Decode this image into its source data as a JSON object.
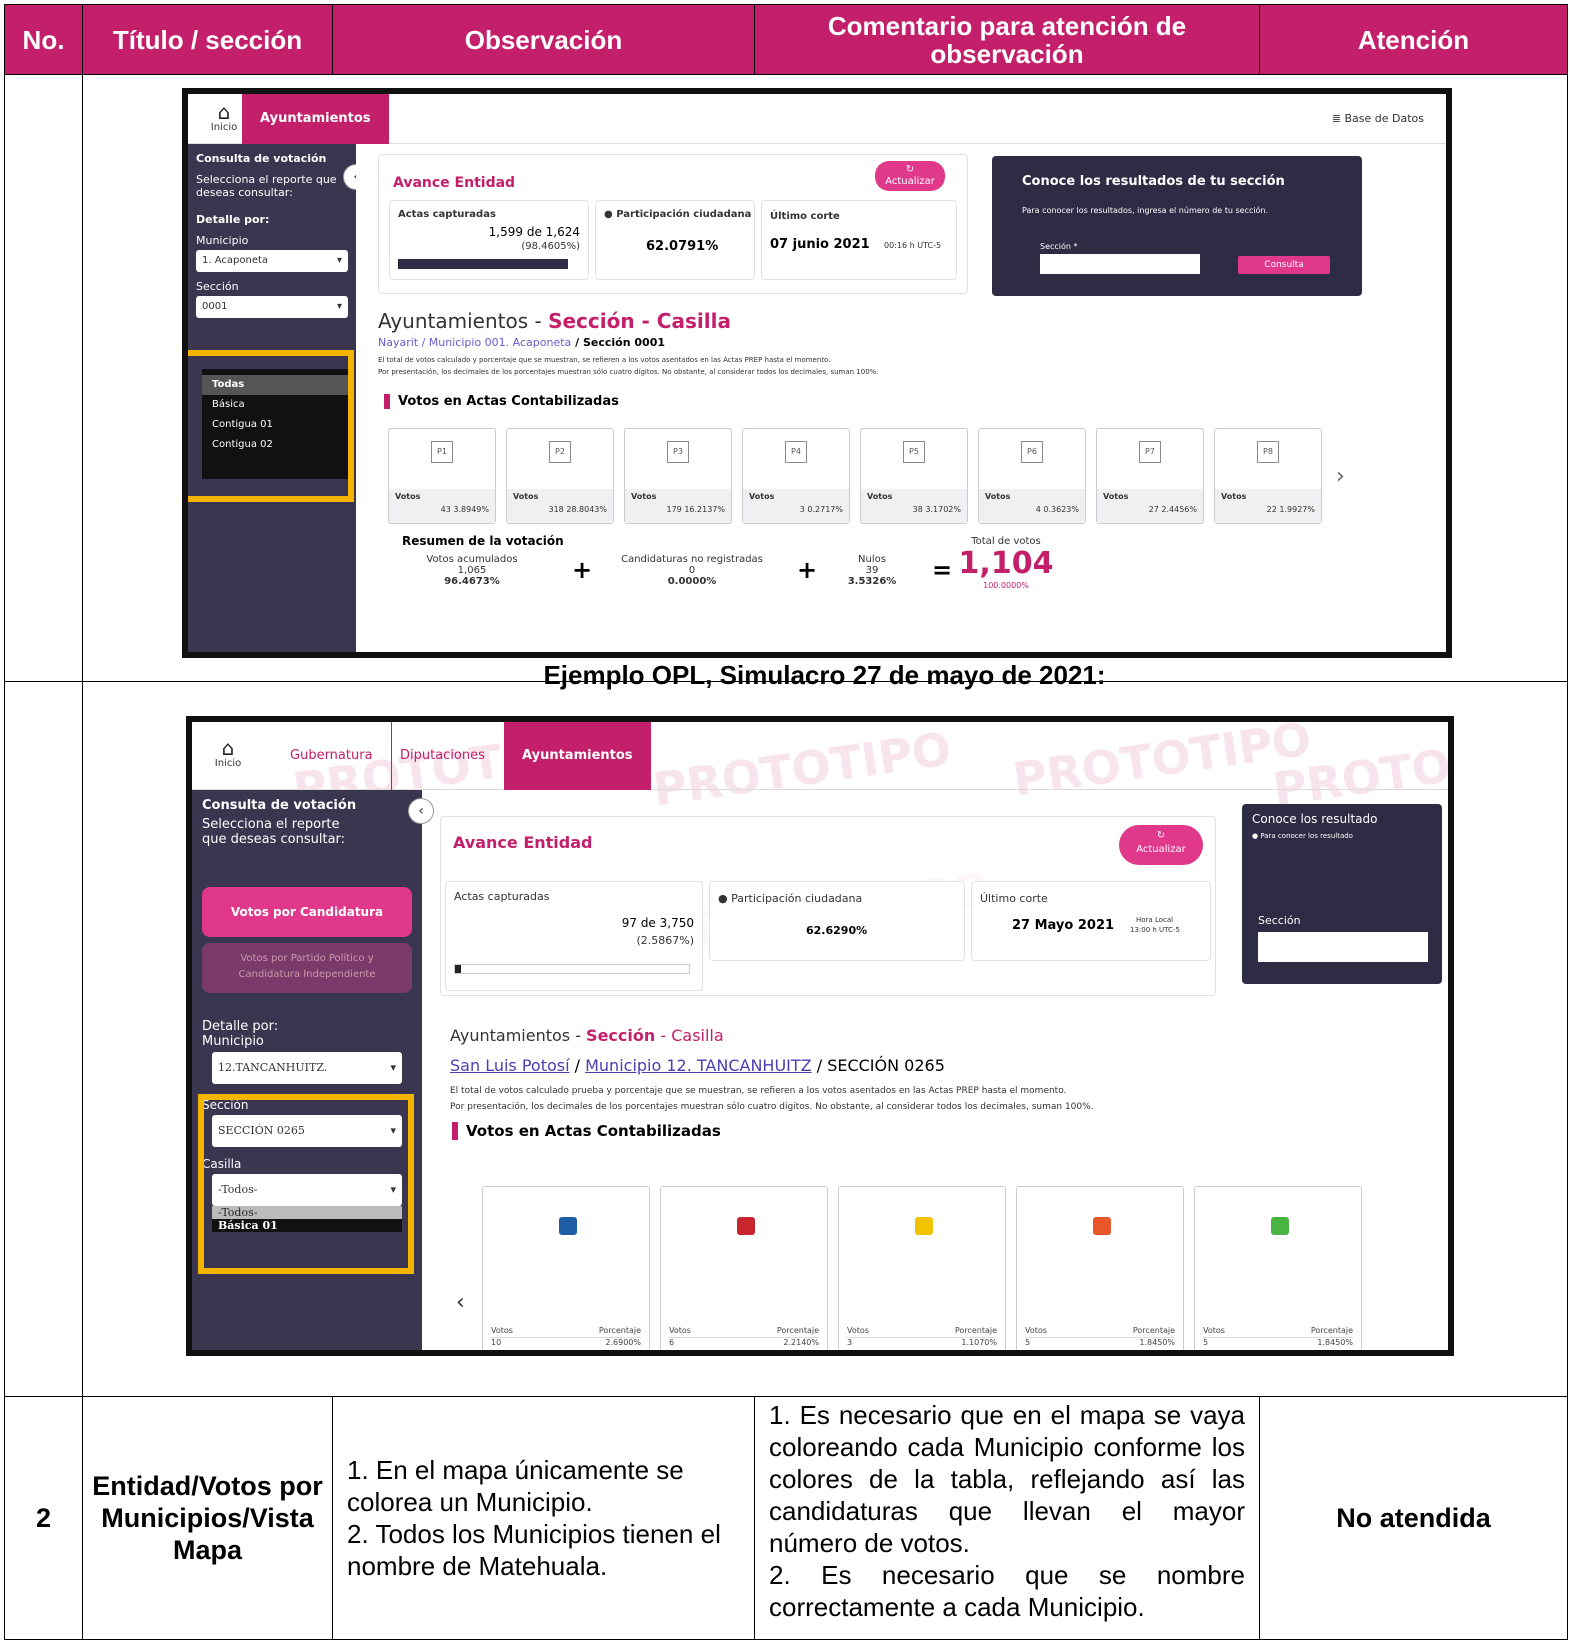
{
  "table": {
    "headers": {
      "no": "No.",
      "titulo": "Título / sección",
      "observacion": "Observación",
      "comentario": "Comentario para atención de observación",
      "atencion": "Atención"
    },
    "example_caption": "Ejemplo OPL, Simulacro 27 de mayo de 2021:",
    "row2": {
      "no": "2",
      "titulo": "Entidad/Votos por Municipios/Vista Mapa",
      "observacion_1": "1. En el mapa únicamente se colorea un Municipio.",
      "observacion_2": "2. Todos los Municipios tienen el nombre de Matehuala.",
      "comentario_1": "1. Es necesario que en el mapa se vaya coloreando cada Municipio conforme los colores de la tabla, reflejando así las candidaturas que llevan el mayor número de votos.",
      "comentario_2": "2. Es necesario que se nombre correctamente a cada Municipio.",
      "atencion": "No atendida"
    }
  },
  "shot1": {
    "home_label": "Inicio",
    "tab_active": "Ayuntamientos",
    "db_link": "Base de Datos",
    "side_title": "Consulta de votación",
    "side_sub": "Selecciona el reporte que deseas consultar:",
    "detalle": "Detalle por:",
    "municipio_label": "Municipio",
    "municipio_val": "1. Acaponeta",
    "seccion_label": "Sección",
    "seccion_val": "0001",
    "casilla_opts": [
      "Todas",
      "Básica",
      "Contigua 01",
      "Contigua 02"
    ],
    "avance": "Avance Entidad",
    "actualizar": "Actualizar",
    "actas_label": "Actas capturadas",
    "actas_val": "1,599 de 1,624",
    "actas_pct": "(98.4605%)",
    "participacion_label": "Participación ciudadana",
    "participacion_val": "62.0791%",
    "corte_label": "Último corte",
    "corte_val": "07 junio 2021",
    "corte_hora": "00:16 h UTC-5",
    "conoce": "Conoce los resultados de tu sección",
    "conoce_sub": "Para conocer los resultados, ingresa el número de tu sección.",
    "seccion_input": "Sección *",
    "consulta_btn": "Consulta",
    "heading_a": "Ayuntamientos - ",
    "heading_b": "Sección - Casilla",
    "breadcrumb_a": "Nayarit / Municipio 001. Acaponeta",
    "breadcrumb_b": " / Sección 0001",
    "note1": "El total de votos calculado y porcentaje que se muestran, se refieren a los votos asentados en las Actas PREP hasta el momento.",
    "note2": "Por presentación, los decimales de los porcentajes muestran sólo cuatro dígitos. No obstante, al considerar todos los decimales, suman 100%.",
    "votos_title": "Votos en Actas Contabilizadas",
    "parties": [
      "P1",
      "P2",
      "P3",
      "P4",
      "P5",
      "P6",
      "P7",
      "P8"
    ],
    "party_votes": [
      "43  3.8949%",
      "318  28.8043%",
      "179  16.2137%",
      "3  0.2717%",
      "38  3.1702%",
      "4  0.3623%",
      "27  2.4456%",
      "22  1.9927%"
    ],
    "votos_label": "Votos",
    "resumen": "Resumen de la votación",
    "acumulados_label": "Votos acumulados",
    "acumulados_val": "1,065",
    "acumulados_pct": "96.4673%",
    "noreg_label": "Candidaturas no registradas",
    "noreg_val": "0",
    "noreg_pct": "0.0000%",
    "nulos_label": "Nulos",
    "nulos_val": "39",
    "nulos_pct": "3.5326%",
    "total_label": "Total de votos",
    "total_val": "1,104",
    "total_pct": "100.0000%"
  },
  "shot2": {
    "home_label": "Inicio",
    "tab1": "Gubernatura",
    "tab2": "Diputaciones",
    "tab3": "Ayuntamientos",
    "watermark": "PROTOTIPO",
    "side_title": "Consulta de votación",
    "side_sub": "Selecciona el reporte que deseas consultar:",
    "btn_candidatura": "Votos por Candidatura",
    "btn_partido": "Votos por Partido Político y Candidatura Independiente",
    "detalle": "Detalle por:",
    "municipio_label": "Municipio",
    "municipio_val": "12.TANCANHUITZ.",
    "seccion_label": "Sección",
    "seccion_val": "SECCIÓN 0265",
    "casilla_label": "Casilla",
    "casilla_val": "-Todos-",
    "casilla_opts": [
      "-Todos-",
      "Básica 01"
    ],
    "avance": "Avance Entidad",
    "actualizar": "Actualizar",
    "actas_label": "Actas capturadas",
    "actas_val": "97 de 3,750",
    "actas_pct": "(2.5867%)",
    "participacion_label": "Participación ciudadana",
    "participacion_val": "62.6290%",
    "corte_label": "Último corte",
    "corte_val": "27 Mayo 2021",
    "corte_hora_label": "Hora Local",
    "corte_hora": "13:00 h UTC-5",
    "conoce": "Conoce los resultado",
    "conoce_sub": "Para conocer los resultado",
    "seccion_input": "Sección",
    "heading_a": "Ayuntamientos - ",
    "heading_b": "Sección",
    "heading_c": " - Casilla",
    "breadcrumb_a": "San Luis Potosí",
    "breadcrumb_sep": " / ",
    "breadcrumb_b": "Municipio 12. TANCANHUITZ",
    "breadcrumb_c": " / SECCIÓN 0265",
    "note1": "El total de votos calculado prueba y porcentaje que se muestran, se refieren a los votos asentados en las Actas PREP hasta el momento.",
    "note2": "Por presentación, los decimales de los porcentajes muestran sólo cuatro dígitos. No obstante, al considerar todos los decimales, suman 100%.",
    "votos_title": "Votos en Actas Contabilizadas",
    "votos_label": "Votos",
    "porcentaje_label": "Porcentaje",
    "cards": [
      {
        "votes": "10",
        "pct": "2.6900%",
        "color": "#1f5fa8"
      },
      {
        "votes": "6",
        "pct": "2.2140%",
        "color": "#c8262e"
      },
      {
        "votes": "3",
        "pct": "1.1070%",
        "color": "#f2c300"
      },
      {
        "votes": "5",
        "pct": "1.8450%",
        "color": "#e8562a"
      },
      {
        "votes": "5",
        "pct": "1.8450%",
        "color": "#4bb543"
      }
    ]
  },
  "colors": {
    "accent": "#c41f6a",
    "header_bg": "#c41f6a",
    "highlight": "#f4b400",
    "sidebar": "#3a3650"
  }
}
